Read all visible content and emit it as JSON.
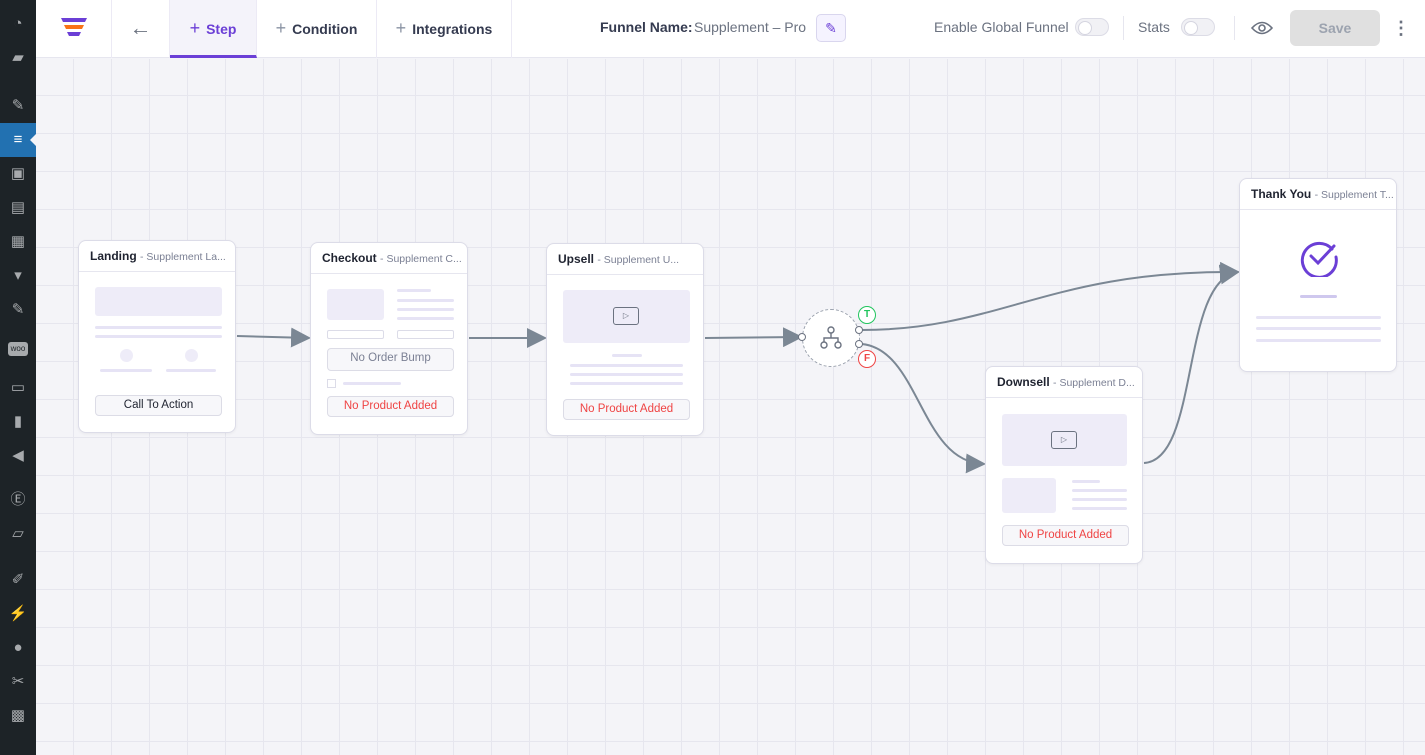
{
  "sidebar": {
    "icons": [
      "dashboard-icon",
      "posts-icon",
      "pin-icon",
      "funnel-icon",
      "media-icon",
      "pages-icon",
      "products-icon",
      "comments-icon",
      "pin-icon-2",
      "woocommerce-icon",
      "archive-icon",
      "analytics-icon",
      "marketing-icon",
      "elementor-icon",
      "folder-icon",
      "appearance-icon",
      "plugins-icon",
      "users-icon",
      "tools-icon",
      "settings-icon"
    ],
    "woo_label": "woo"
  },
  "header": {
    "tabs": [
      {
        "label": "Step",
        "active": true
      },
      {
        "label": "Condition"
      },
      {
        "label": "Integrations"
      }
    ],
    "funnel_name_label": "Funnel Name:",
    "funnel_name": "Supplement – Pro",
    "enable_global_label": "Enable Global Funnel",
    "stats_label": "Stats",
    "save_label": "Save",
    "enable_global_on": false,
    "stats_on": false
  },
  "nodes": {
    "landing": {
      "type": "Landing",
      "name": "- Supplement La...",
      "button": "Call To Action"
    },
    "checkout": {
      "type": "Checkout",
      "name": "- Supplement C...",
      "order_bump": "No Order Bump",
      "product": "No Product Added"
    },
    "upsell": {
      "type": "Upsell",
      "name": "- Supplement U...",
      "product": "No Product Added"
    },
    "downsell": {
      "type": "Downsell",
      "name": "- Supplement D...",
      "product": "No Product Added"
    },
    "thankyou": {
      "type": "Thank You",
      "name": "- Supplement T..."
    },
    "condition": {
      "true_label": "T",
      "false_label": "F"
    }
  },
  "colors": {
    "accent": "#6b3fd6",
    "error": "#ef4444",
    "true": "#22c55e",
    "edge": "#7b8794"
  }
}
